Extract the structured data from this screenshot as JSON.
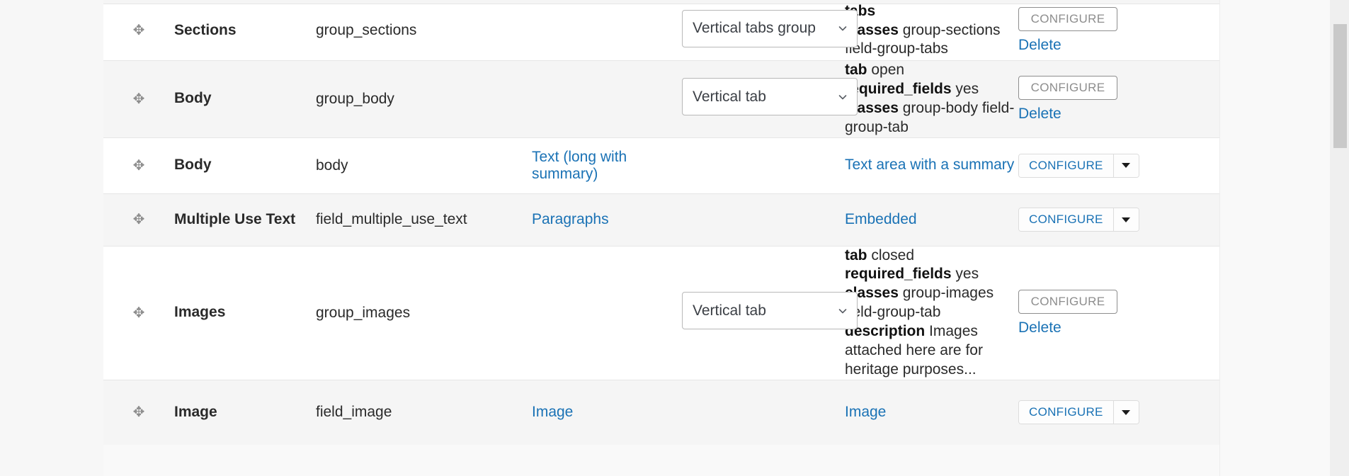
{
  "icons": {
    "drag_handle": "drag-handle-icon",
    "select_caret": "chevron-down-icon",
    "dropbutton_caret": "triangle-down-icon"
  },
  "colors": {
    "link": "#1a72b5",
    "row_odd": "#ffffff",
    "row_even": "#f5f5f5",
    "button_border_grey": "#8e8e8e",
    "button_text_grey": "#8d8d8d",
    "page_bg": "#f9f9f9",
    "scrollbar_thumb": "#c9c9c9"
  },
  "rows": [
    {
      "label": "Sections",
      "machine_name": "group_sections",
      "indent": 0,
      "widget_select": "Vertical tabs group",
      "summary": [
        {
          "key": "tabs",
          "value": ""
        },
        {
          "key": "classes",
          "value": "group-sections field-group-tabs"
        }
      ],
      "ops": {
        "type": "grey",
        "configure": "CONFIGURE",
        "delete": "Delete"
      }
    },
    {
      "label": "Body",
      "machine_name": "group_body",
      "indent": 1,
      "widget_select": "Vertical tab",
      "summary": [
        {
          "key": "tab",
          "value": "open"
        },
        {
          "key": "required_fields",
          "value": "yes"
        },
        {
          "key": "classes",
          "value": "group-body field-group-tab"
        }
      ],
      "ops": {
        "type": "grey",
        "configure": "CONFIGURE",
        "delete": "Delete"
      }
    },
    {
      "label": "Body",
      "machine_name": "body",
      "indent": 2,
      "field_type": "Text (long with summary)",
      "widget_link": "Text area with a summary",
      "ops": {
        "type": "dropbutton",
        "configure": "CONFIGURE"
      }
    },
    {
      "label": "Multiple Use Text",
      "machine_name": "field_multiple_use_text",
      "indent": 2,
      "field_type": "Paragraphs",
      "widget_link": "Embedded",
      "ops": {
        "type": "dropbutton",
        "configure": "CONFIGURE"
      }
    },
    {
      "label": "Images",
      "machine_name": "group_images",
      "indent": 1,
      "widget_select": "Vertical tab",
      "summary": [
        {
          "key": "tab",
          "value": "closed"
        },
        {
          "key": "required_fields",
          "value": "yes"
        },
        {
          "key": "classes",
          "value": "group-images field-group-tab"
        },
        {
          "key": "description",
          "value": "Images attached here are for heritage purposes..."
        }
      ],
      "ops": {
        "type": "grey",
        "configure": "CONFIGURE",
        "delete": "Delete"
      }
    },
    {
      "label": "Image",
      "machine_name": "field_image",
      "indent": 2,
      "field_type": "Image",
      "widget_link": "Image",
      "ops": {
        "type": "dropbutton",
        "configure": "CONFIGURE"
      }
    }
  ]
}
